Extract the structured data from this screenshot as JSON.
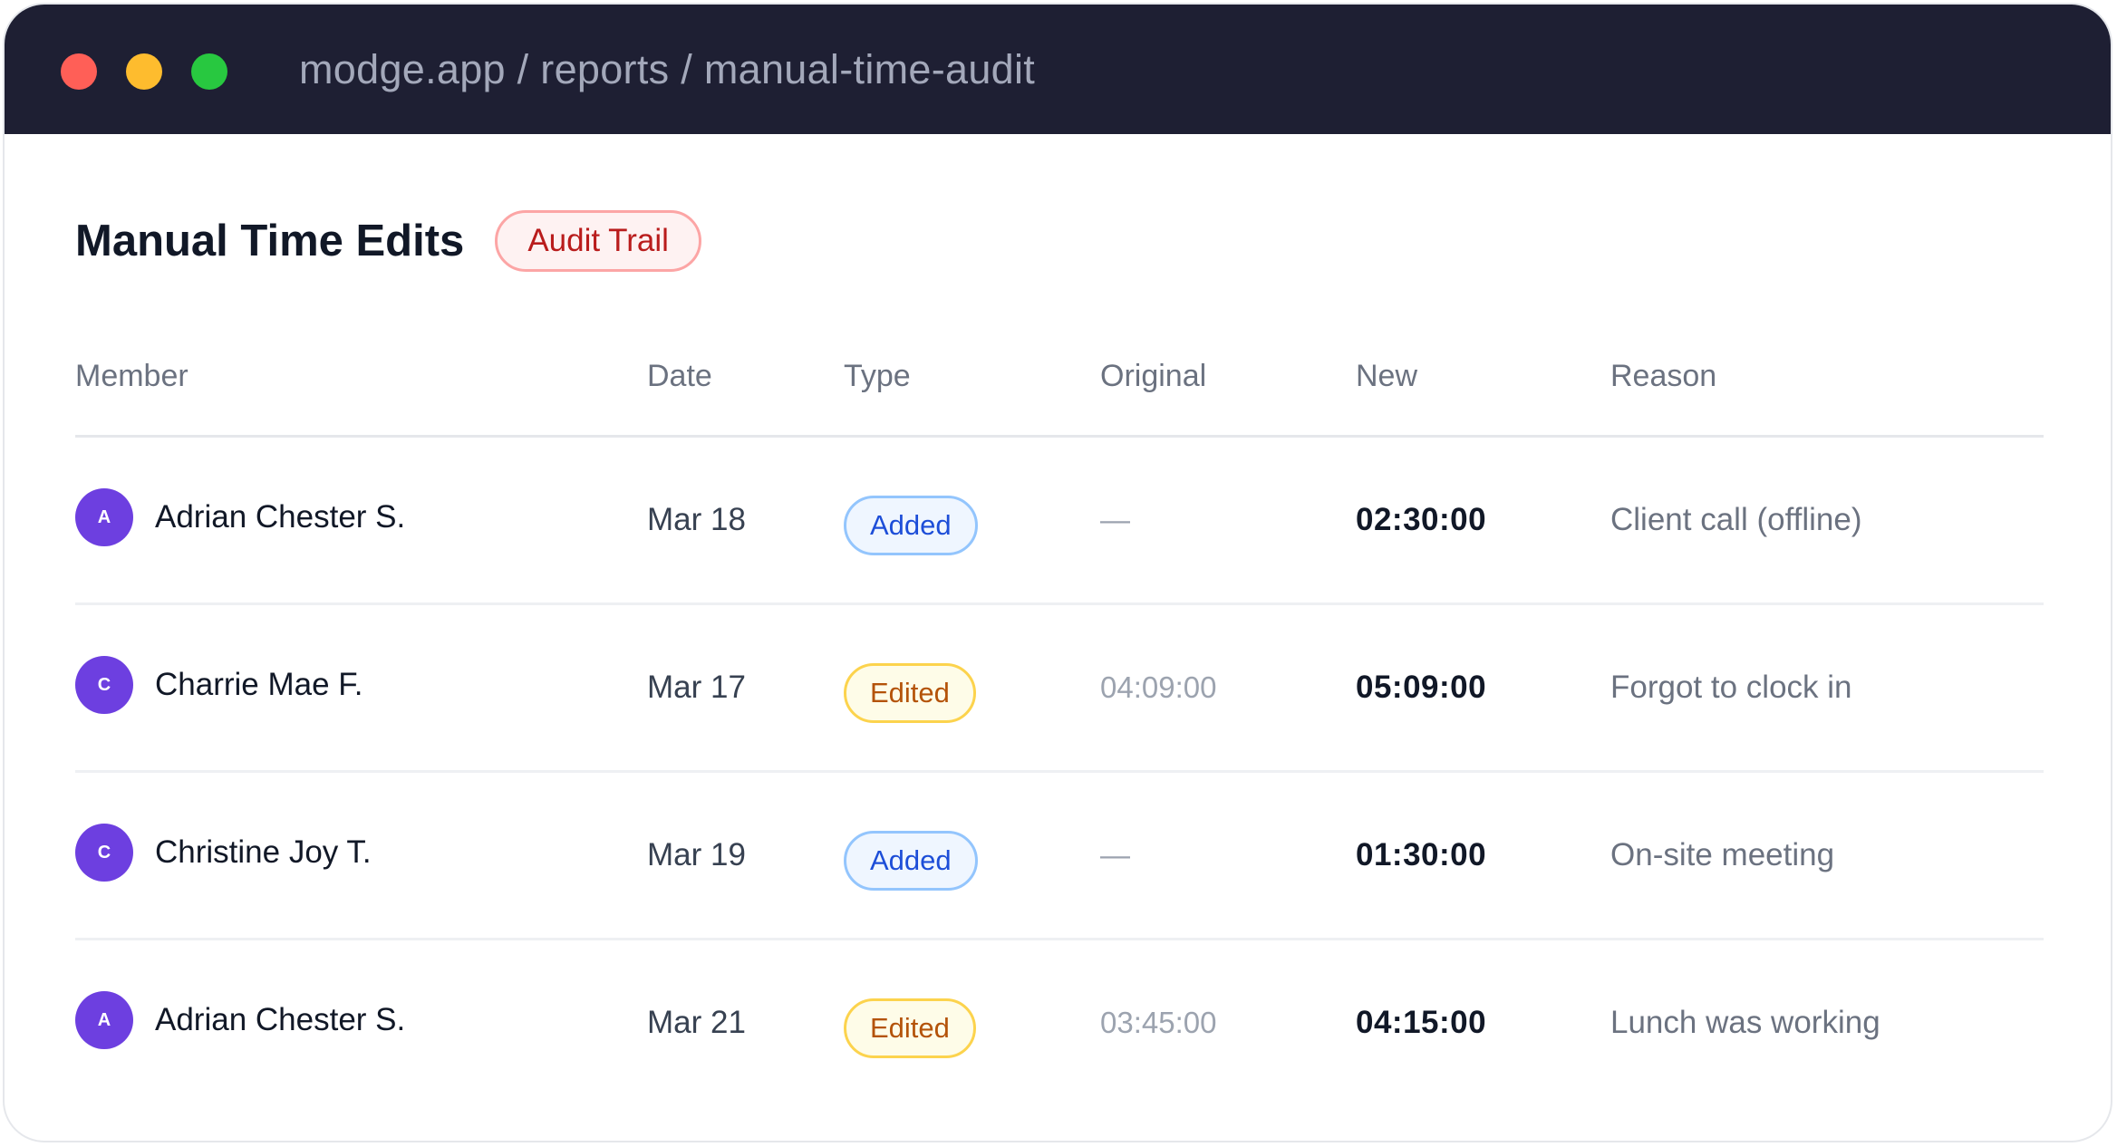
{
  "window": {
    "url": "modge.app / reports / manual-time-audit",
    "controls": [
      "close",
      "minimize",
      "maximize"
    ]
  },
  "page": {
    "title": "Manual Time Edits",
    "badge": "Audit Trail"
  },
  "table": {
    "headers": {
      "member": "Member",
      "date": "Date",
      "type": "Type",
      "original": "Original",
      "new": "New",
      "reason": "Reason"
    },
    "rows": [
      {
        "initial": "A",
        "member": "Adrian Chester S.",
        "date": "Mar 18",
        "type": "Added",
        "original": "—",
        "new": "02:30:00",
        "reason": "Client call (offline)"
      },
      {
        "initial": "C",
        "member": "Charrie Mae F.",
        "date": "Mar 17",
        "type": "Edited",
        "original": "04:09:00",
        "new": "05:09:00",
        "reason": "Forgot to clock in"
      },
      {
        "initial": "C",
        "member": "Christine Joy T.",
        "date": "Mar 19",
        "type": "Added",
        "original": "—",
        "new": "01:30:00",
        "reason": "On-site meeting"
      },
      {
        "initial": "A",
        "member": "Adrian Chester S.",
        "date": "Mar 21",
        "type": "Edited",
        "original": "03:45:00",
        "new": "04:15:00",
        "reason": "Lunch was working"
      }
    ]
  },
  "colors": {
    "titlebar": "#1e1f33",
    "avatar": "#6d3fe0",
    "added": "#1d4ed8",
    "edited": "#b45309",
    "audit": "#b91c1c"
  }
}
